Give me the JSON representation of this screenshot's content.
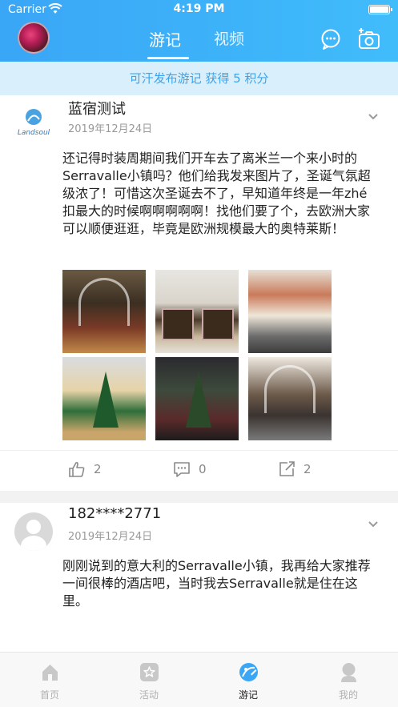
{
  "status_bar": {
    "carrier": "Carrier",
    "time": "4:19 PM"
  },
  "header": {
    "tabs": [
      {
        "label": "游记",
        "active": true
      },
      {
        "label": "视频",
        "active": false
      }
    ],
    "icons": [
      "chat-icon",
      "camera-icon"
    ]
  },
  "banner": {
    "text": "可汗发布游记 获得 5 积分"
  },
  "posts": [
    {
      "author": "蓝宿测试",
      "avatar_text": "Landsoul",
      "date": "2019年12月24日",
      "text": "还记得时装周期间我们开车去了离米兰一个来小时的Serravalle小镇吗？他们给我发来图片了，圣诞气氛超级浓了！可惜这次圣诞去不了，早知道年终是一年zhé扣最大的时候啊啊啊啊啊！找他们要了个，去欧洲大家可以顺便逛逛，毕竟是欧洲规模最大的奥特莱斯！",
      "photo_count": 6,
      "likes": "2",
      "comments": "0",
      "shares": "2"
    },
    {
      "author": "182****2771",
      "date": "2019年12月24日",
      "text": "刚刚说到的意大利的Serravalle小镇，我再给大家推荐一间很棒的酒店吧，当时我去Serravalle就是住在这里。"
    }
  ],
  "tabbar": {
    "items": [
      {
        "label": "首页",
        "icon": "home-icon",
        "active": false
      },
      {
        "label": "活动",
        "icon": "activity-icon",
        "active": false
      },
      {
        "label": "游记",
        "icon": "travel-notes-icon",
        "active": true
      },
      {
        "label": "我的",
        "icon": "profile-icon",
        "active": false
      }
    ]
  },
  "colors": {
    "primary": "#3aa6f6",
    "banner_bg": "#d9effc",
    "banner_text": "#3ba4ee"
  }
}
